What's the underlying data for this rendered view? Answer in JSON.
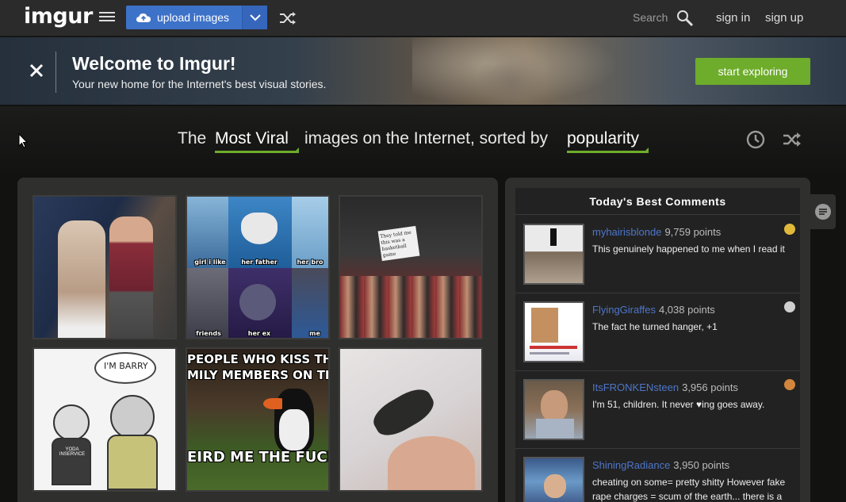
{
  "header": {
    "logo": "imgur",
    "upload_label": "upload images",
    "search_label": "Search",
    "sign_in": "sign in",
    "sign_up": "sign up"
  },
  "banner": {
    "title": "Welcome to Imgur!",
    "subtitle": "Your new home for the Internet's best visual stories.",
    "cta": "start exploring"
  },
  "sort": {
    "prefix": "The",
    "section": "Most Viral",
    "middle": "images on the Internet, sorted by",
    "order": "popularity"
  },
  "gallery": {
    "captions": {
      "shark_left": "girl i like",
      "shark_mid": "her father",
      "shark_right": "her bro",
      "shark_bl": "friends",
      "shark_bm": "her ex",
      "shark_br": "me",
      "sign_text": "They told me this was a basketball game",
      "barry": "I'M BARRY",
      "shirt": "YODA INSERVICE",
      "puffin_top": "PEOPLE WHO KISS THEIR",
      "puffin_top2": "MILY MEMBERS ON THE LI",
      "puffin_bottom": "EIRD ME THE FUCK O"
    }
  },
  "comments": {
    "title": "Today's Best Comments",
    "items": [
      {
        "user": "myhairisblonde",
        "points": "9,759 points",
        "text": "This genuinely happened to me when I read it",
        "medal": "#e0b93a"
      },
      {
        "user": "FlyingGiraffes",
        "points": "4,038 points",
        "text": "The fact he turned hanger, +1",
        "medal": "#cfcfcf"
      },
      {
        "user": "ItsFRONKENsteen",
        "points": "3,956 points",
        "text": "I'm 51, children. It never ♥ing goes away.",
        "medal": "#d2853c"
      },
      {
        "user": "ShiningRadiance",
        "points": "3,950 points",
        "text": "cheating on some= pretty shitty However fake rape charges = scum of the earth... there is a",
        "medal": ""
      }
    ]
  },
  "colors": {
    "accent_green": "#6eac2b",
    "upload_blue": "#3d72c9",
    "username_blue": "#4e76c9"
  }
}
